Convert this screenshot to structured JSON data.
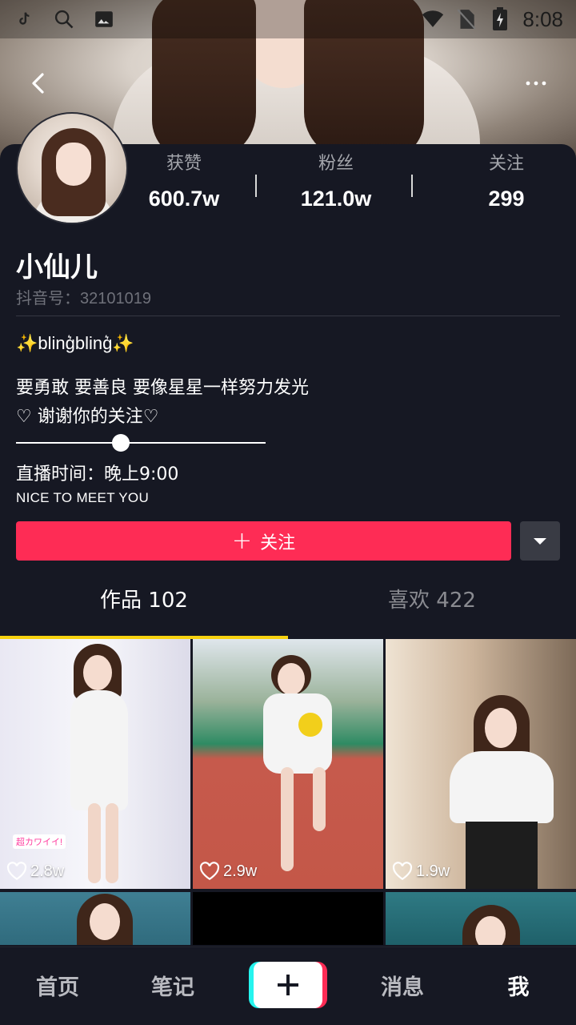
{
  "status_bar": {
    "time": "8:08",
    "icons": [
      "tiktok-icon",
      "search-icon",
      "image-icon",
      "wifi-icon",
      "no-sim-icon",
      "battery-icon"
    ]
  },
  "header": {
    "back_icon": "back-arrow-icon",
    "more_icon": "more-dots-icon"
  },
  "profile": {
    "stats": [
      {
        "label": "获赞",
        "value": "600.7w"
      },
      {
        "label": "粉丝",
        "value": "121.0w"
      },
      {
        "label": "关注",
        "value": "299"
      }
    ],
    "nickname": "小仙儿",
    "douyin_id_label": "抖音号：",
    "douyin_id": "32101019",
    "bio": {
      "line1_sparkle_left": "✨",
      "line1_text": "bling͛bling͛",
      "line1_sparkle_right": "✨",
      "line2": "要勇敢 要善良 要像星星一样努力发光",
      "line3": "♡ 谢谢你的关注♡",
      "slider_progress": 0.42,
      "line5": "直播时间：晚上9:00",
      "line6": "NICE TO MEET YOU"
    },
    "follow_button": {
      "plus": "+",
      "label": "关注"
    },
    "accent_color": "#fe2c55"
  },
  "tabs": [
    {
      "label": "作品 102",
      "active": true
    },
    {
      "label": "喜欢 422",
      "active": false
    }
  ],
  "videos": [
    {
      "likes": "2.8w",
      "tag": "超カワイイ!"
    },
    {
      "likes": "2.9w"
    },
    {
      "likes": "1.9w"
    },
    {
      "likes": ""
    },
    {
      "likes": ""
    },
    {
      "likes": ""
    }
  ],
  "bottom_nav": {
    "home": "首页",
    "notes": "笔记",
    "create": "+",
    "messages": "消息",
    "me": "我"
  }
}
